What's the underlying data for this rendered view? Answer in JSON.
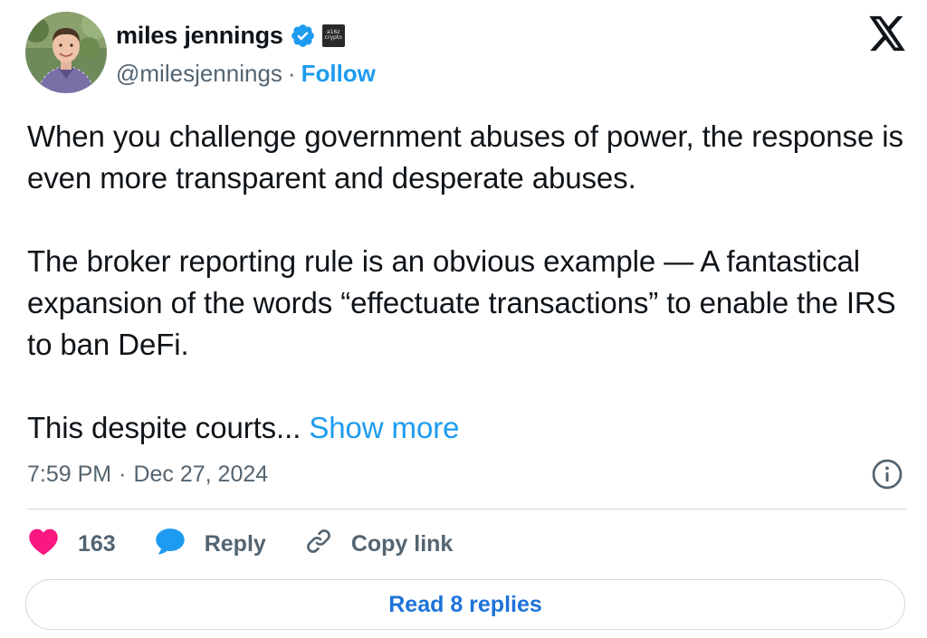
{
  "author": {
    "display_name": "miles jennings",
    "handle": "@milesjennings",
    "separator": "·",
    "follow_label": "Follow",
    "affiliate_badge_text": "a16z crypto",
    "verified_icon": "verified-badge-icon"
  },
  "tweet": {
    "paragraphs": [
      "When you challenge government abuses of power, the response is even more transparent and desperate abuses.",
      "The broker reporting rule is an obvious example — A fantastical expansion of the words “effectuate transactions” to enable the IRS to ban DeFi.",
      "This despite courts..."
    ],
    "show_more_label": "Show more",
    "time": "7:59 PM",
    "date_separator": "·",
    "date": "Dec 27, 2024"
  },
  "actions": {
    "like_count": "163",
    "reply_label": "Reply",
    "copy_link_label": "Copy link",
    "read_replies_label": "Read 8 replies"
  },
  "colors": {
    "accent": "#1d9bf0",
    "like": "#f91880",
    "muted": "#536471",
    "text": "#0f1419",
    "border": "#cfd9de"
  }
}
